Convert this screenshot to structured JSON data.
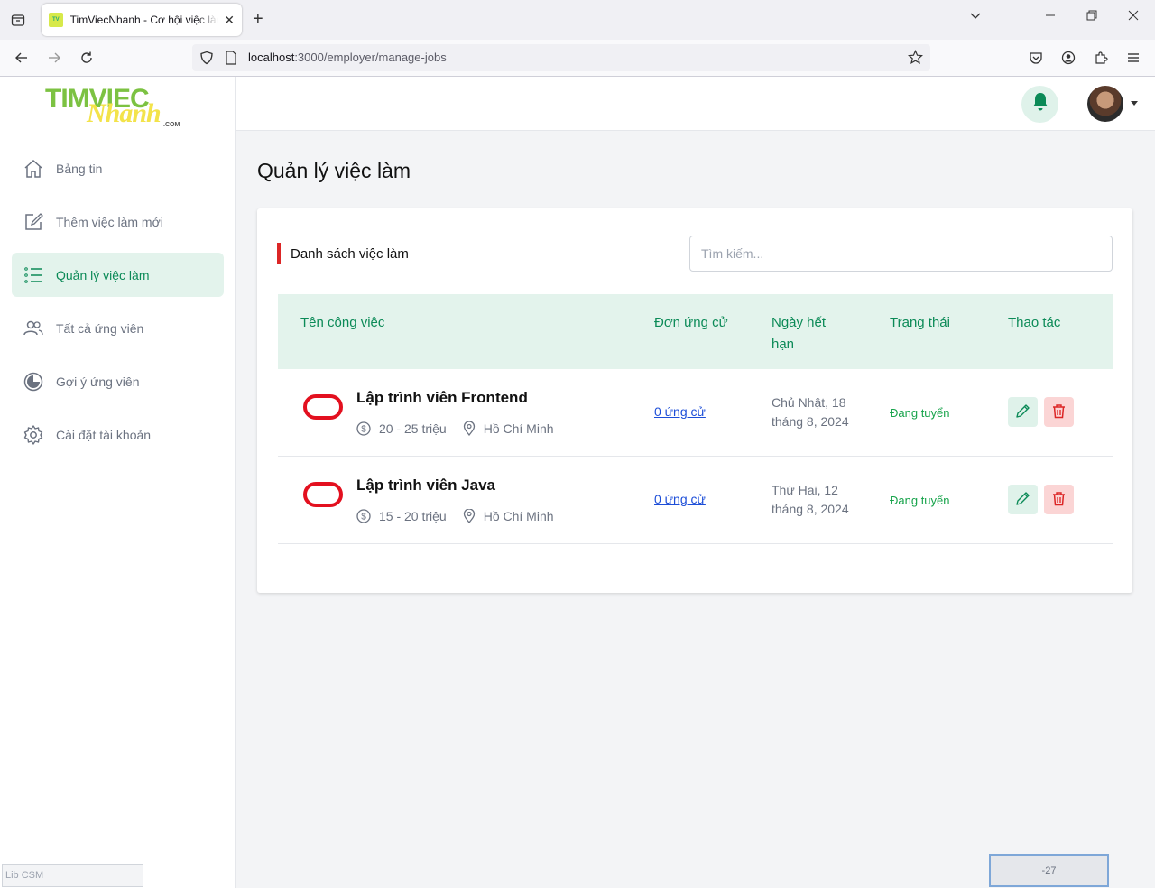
{
  "browser": {
    "tab_title": "TimViecNhanh - Cơ hội việc làm",
    "url_host": "localhost",
    "url_path": ":3000/employer/manage-jobs"
  },
  "logo": {
    "line1": "TIMVIEC",
    "line2": "Nhanh",
    "line3": ".COM"
  },
  "sidebar": {
    "items": [
      {
        "label": "Bảng tin",
        "icon": "home-icon"
      },
      {
        "label": "Thêm việc làm mới",
        "icon": "edit-square-icon"
      },
      {
        "label": "Quản lý việc làm",
        "icon": "list-icon",
        "active": true
      },
      {
        "label": "Tất cả ứng viên",
        "icon": "users-icon"
      },
      {
        "label": "Gợi ý ứng viên",
        "icon": "pie-chart-icon"
      },
      {
        "label": "Cài đặt tài khoản",
        "icon": "gear-icon"
      }
    ]
  },
  "page": {
    "title": "Quản lý việc làm",
    "section_title": "Danh sách việc làm",
    "search_placeholder": "Tìm kiếm..."
  },
  "table": {
    "headers": [
      "Tên công việc",
      "Đơn ứng cử",
      "Ngày hết hạn",
      "Trạng thái",
      "Thao tác"
    ],
    "rows": [
      {
        "title": "Lập trình viên Frontend",
        "salary": "20 - 25 triệu",
        "location": "Hồ Chí Minh",
        "applications": "0 ứng cử",
        "expiry_line1": "Chủ Nhật, 18",
        "expiry_line2": "tháng 8, 2024",
        "status": "Đang tuyển"
      },
      {
        "title": "Lập trình viên Java",
        "salary": "15 - 20 triệu",
        "location": "Hồ Chí Minh",
        "applications": "0 ứng cử",
        "expiry_line1": "Thứ Hai, 12",
        "expiry_line2": "tháng 8, 2024",
        "status": "Đang tuyển"
      }
    ]
  },
  "footer": {
    "lib_label": "Lib CSM",
    "counter": "-27"
  },
  "colors": {
    "accent": "#0b8a57",
    "accent_bg": "#e3f3ec",
    "danger": "#dc2626",
    "status": "#16a34a"
  }
}
